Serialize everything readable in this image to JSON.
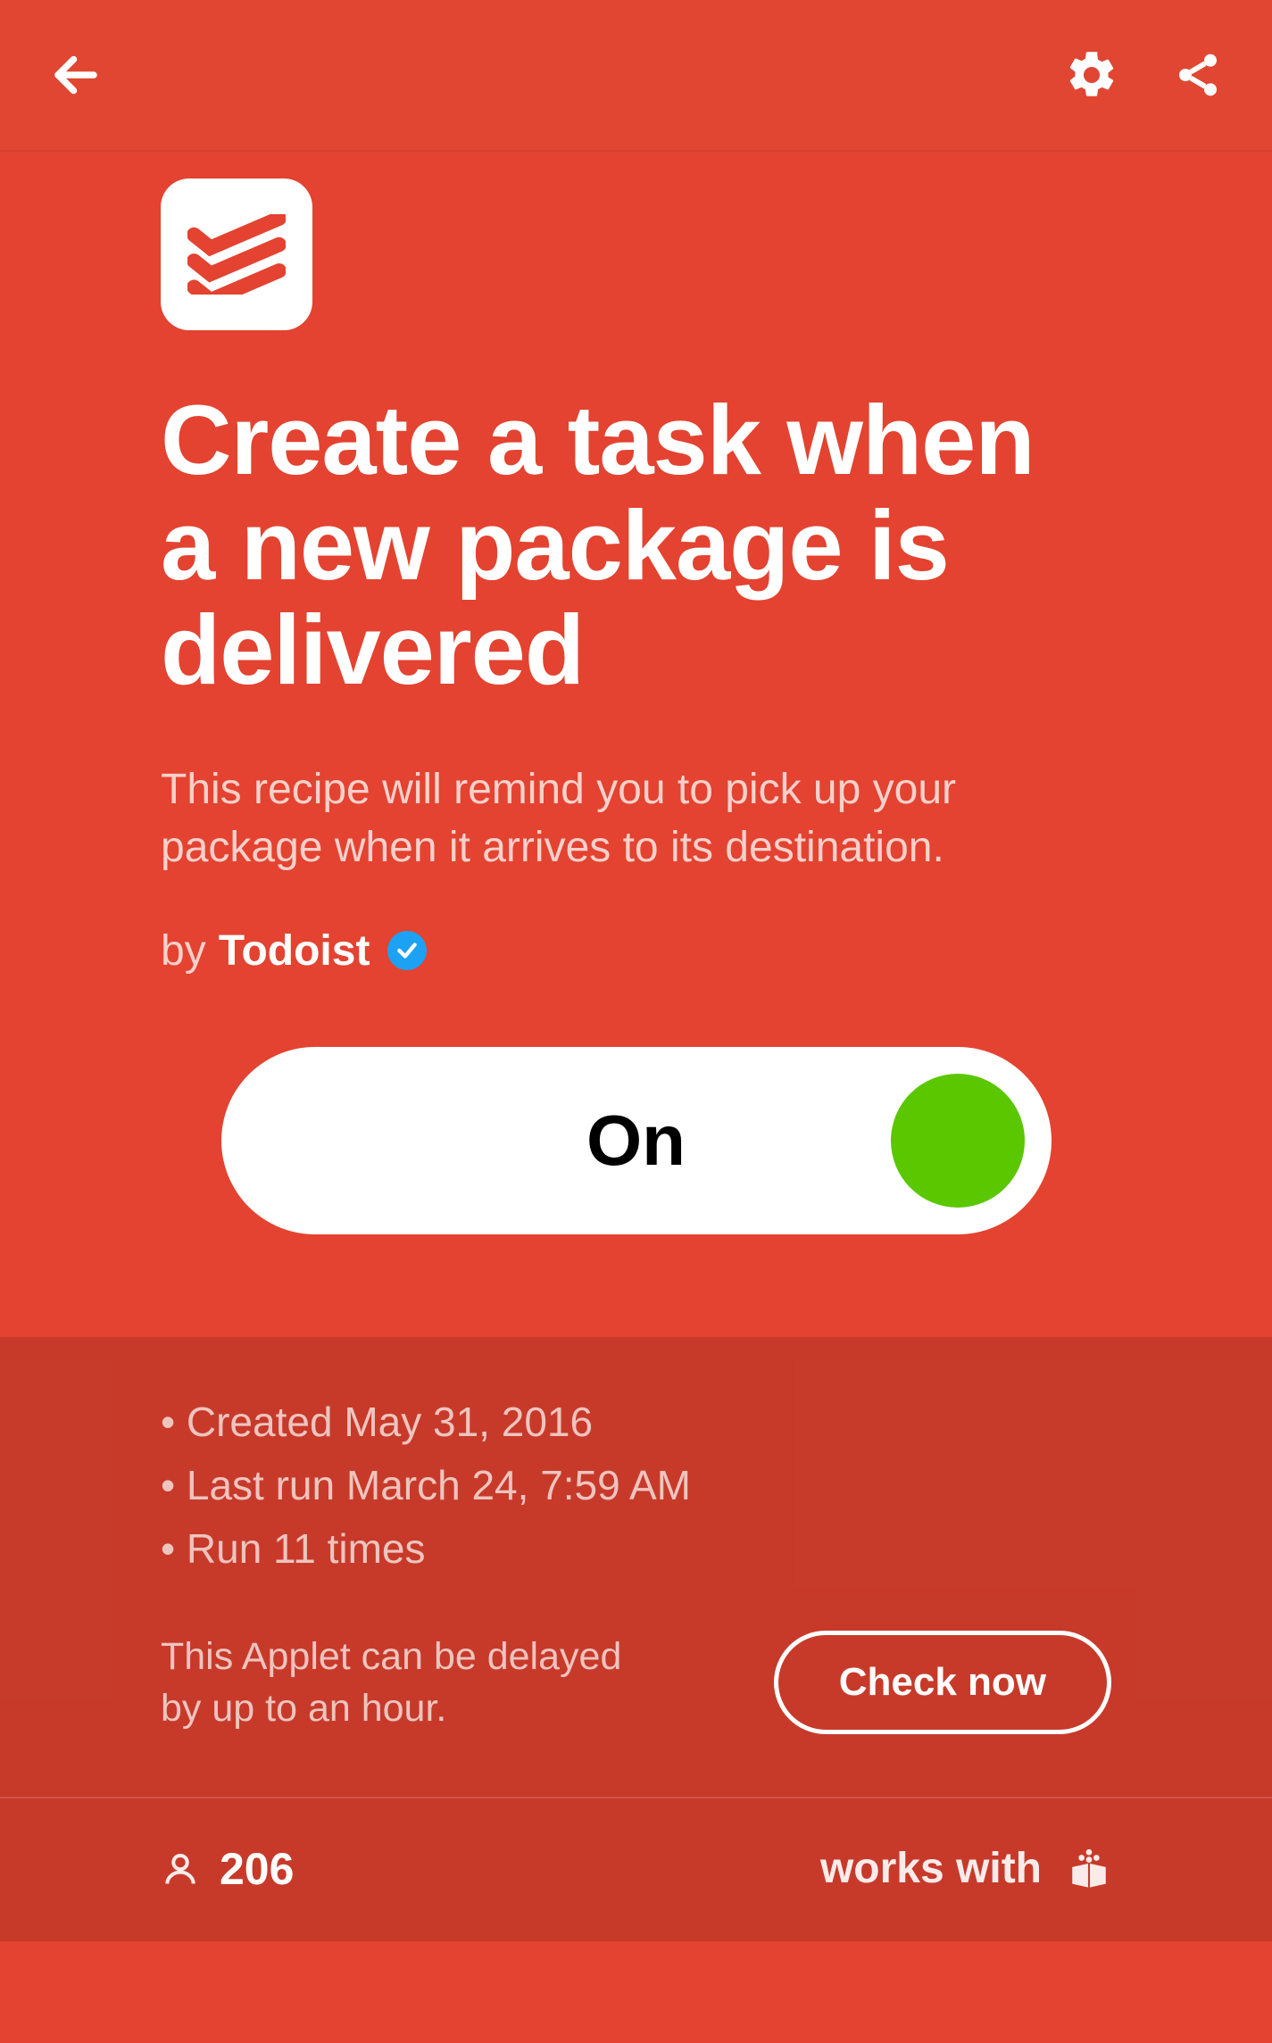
{
  "header": {
    "back_icon": "back",
    "settings_icon": "settings",
    "share_icon": "share"
  },
  "applet": {
    "service_icon": "todoist",
    "title": "Create a task when a new package is delivered",
    "description": "This recipe will remind you to pick up your package when it arrives to its destination.",
    "by_label": "by",
    "author": "Todoist",
    "verified": true,
    "toggle": {
      "state": "on",
      "label": "On"
    }
  },
  "meta": {
    "items": [
      "Created May 31, 2016",
      "Last run March 24, 7:59 AM",
      "Run 11 times"
    ],
    "delay_text": "This Applet can be delayed by up to an hour.",
    "check_button": "Check now"
  },
  "footer": {
    "user_count": "206",
    "works_with_label": "works with",
    "works_with_icon": "slice"
  }
}
